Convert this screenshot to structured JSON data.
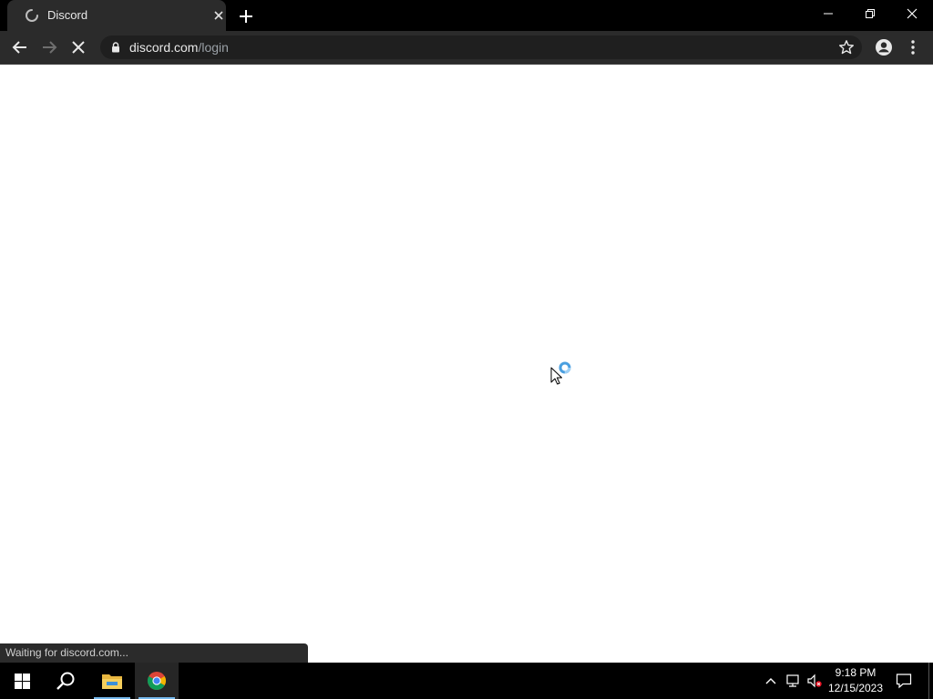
{
  "tab": {
    "title": "Discord"
  },
  "address": {
    "host": "discord.com",
    "path": "/login"
  },
  "status": {
    "text": "Waiting for discord.com..."
  },
  "clock": {
    "time": "9:18 PM",
    "date": "12/15/2023"
  },
  "colors": {
    "accent": "#76b9ed",
    "loading": "#4a9fe0"
  },
  "icons": [
    "loading-spinner-icon",
    "close-icon",
    "plus-icon",
    "minimize-icon",
    "restore-icon",
    "back-arrow-icon",
    "forward-arrow-icon",
    "stop-icon",
    "lock-icon",
    "star-icon",
    "profile-icon",
    "kebab-menu-icon",
    "windows-icon",
    "search-icon",
    "file-explorer-icon",
    "chrome-icon",
    "chevron-up-icon",
    "network-icon",
    "volume-muted-icon",
    "notification-icon"
  ]
}
